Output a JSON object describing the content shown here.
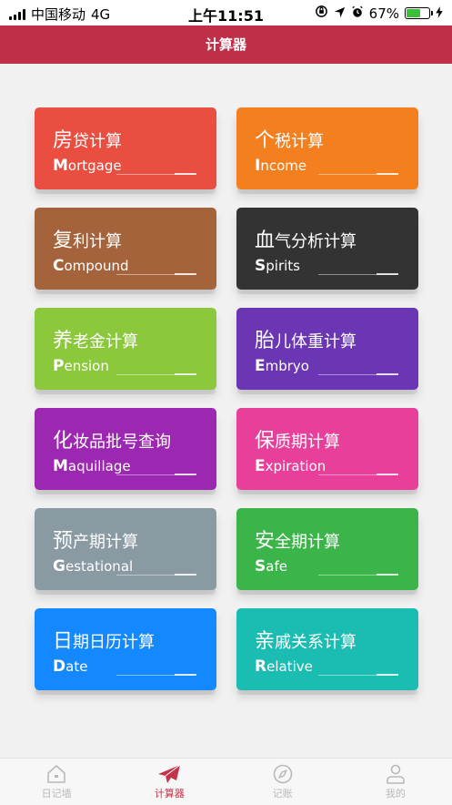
{
  "status": {
    "carrier": "中国移动",
    "network": "4G",
    "time": "上午11:51",
    "battery_pct": "67%",
    "battery_level": 0.67
  },
  "header": {
    "title": "计算器"
  },
  "cards": [
    {
      "title_first": "房",
      "title_rest": "贷计算",
      "sub_first": "M",
      "sub_rest": "ortgage",
      "color": "#e94e40"
    },
    {
      "title_first": "个",
      "title_rest": "税计算",
      "sub_first": "I",
      "sub_rest": "ncome",
      "color": "#f47f1f"
    },
    {
      "title_first": "复",
      "title_rest": "利计算",
      "sub_first": "C",
      "sub_rest": "ompound",
      "color": "#a4633b"
    },
    {
      "title_first": "血",
      "title_rest": "气分析计算",
      "sub_first": "S",
      "sub_rest": "pirits",
      "color": "#333333"
    },
    {
      "title_first": "养",
      "title_rest": "老金计算",
      "sub_first": "P",
      "sub_rest": "ension",
      "color": "#8cc83c"
    },
    {
      "title_first": "胎",
      "title_rest": "儿体重计算",
      "sub_first": "E",
      "sub_rest": "mbryo",
      "color": "#6a36b3"
    },
    {
      "title_first": "化",
      "title_rest": "妆品批号查询",
      "sub_first": "M",
      "sub_rest": "aquillage",
      "color": "#9c27b0"
    },
    {
      "title_first": "保",
      "title_rest": "质期计算",
      "sub_first": "E",
      "sub_rest": "xpiration",
      "color": "#e8409a"
    },
    {
      "title_first": "预",
      "title_rest": "产期计算",
      "sub_first": "G",
      "sub_rest": "estational",
      "color": "#8a9aa3"
    },
    {
      "title_first": "安",
      "title_rest": "全期计算",
      "sub_first": "S",
      "sub_rest": "afe",
      "color": "#3bb54a"
    },
    {
      "title_first": "日",
      "title_rest": "期日历计算",
      "sub_first": "D",
      "sub_rest": "ate",
      "color": "#1489ff"
    },
    {
      "title_first": "亲",
      "title_rest": "戚关系计算",
      "sub_first": "R",
      "sub_rest": "elative",
      "color": "#1bbdb3"
    }
  ],
  "tabs": [
    {
      "label": "日记墙",
      "icon": "home-icon"
    },
    {
      "label": "计算器",
      "icon": "paper-plane-icon"
    },
    {
      "label": "记账",
      "icon": "compass-icon"
    },
    {
      "label": "我的",
      "icon": "user-icon"
    }
  ],
  "colors": {
    "header_bg": "#bf2f47",
    "tab_active": "#c3334a",
    "tab_inactive": "#b9b9b9"
  }
}
